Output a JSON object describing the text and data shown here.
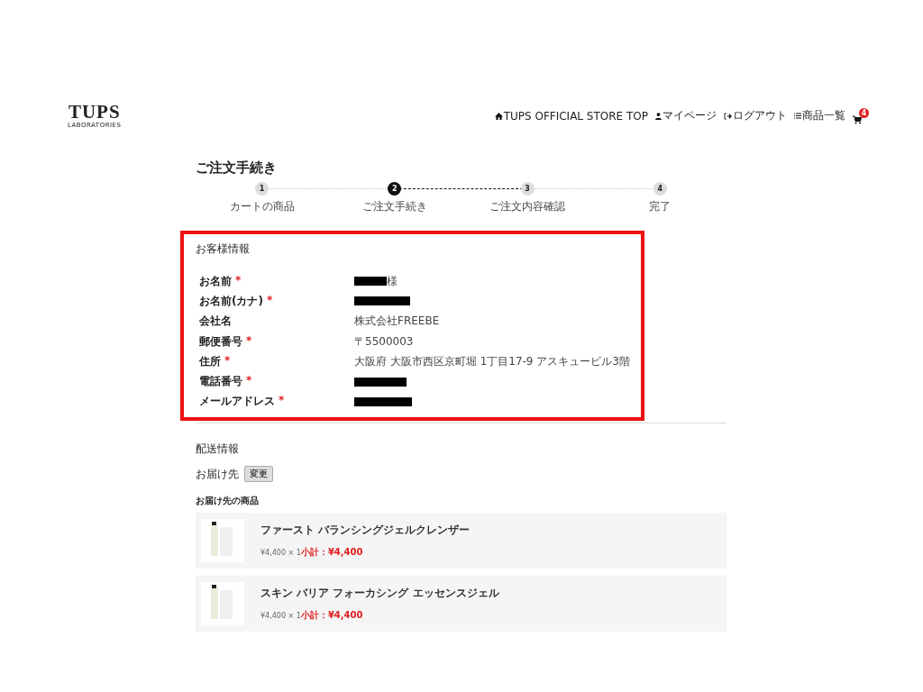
{
  "header": {
    "logo": {
      "title": "TUPS",
      "subtitle": "LABORATORIES"
    },
    "nav": [
      {
        "kind": "home",
        "label": "TUPS OFFICIAL STORE TOP"
      },
      {
        "kind": "user",
        "label": "マイページ"
      },
      {
        "kind": "logout",
        "label": "ログアウト"
      },
      {
        "kind": "list",
        "label": "商品一覧"
      },
      {
        "kind": "cart",
        "badge": "4"
      }
    ]
  },
  "page_title": "ご注文手続き",
  "steps": [
    {
      "number": "1",
      "label": "カートの商品",
      "selected": false
    },
    {
      "number": "2",
      "label": "ご注文手続き",
      "selected": true
    },
    {
      "number": "3",
      "label": "ご注文内容確認",
      "selected": false
    },
    {
      "number": "4",
      "label": "完了",
      "selected": false
    }
  ],
  "customer": {
    "title": "お客様情報",
    "highlighted": true,
    "rows": [
      {
        "label": "お名前",
        "required_mark": "*",
        "redacted": true,
        "suffix": "様"
      },
      {
        "label": "お名前(カナ)",
        "required_mark": "*",
        "redacted": true
      },
      {
        "label": "会社名",
        "value": "株式会社FREEBE"
      },
      {
        "label": "郵便番号",
        "required_mark": "*",
        "value": "〒5500003"
      },
      {
        "label": "住所",
        "required_mark": "*",
        "value": "大阪府 大阪市西区京町堀 1丁目17-9 アスキュービル3階"
      },
      {
        "label": "電話番号",
        "required_mark": "*",
        "redacted": true
      },
      {
        "label": "メールアドレス",
        "required_mark": "*",
        "redacted": true
      }
    ]
  },
  "shipping": {
    "title": "配送情報",
    "destination_title": "お届け先",
    "change_button": "変更",
    "items_title": "お届け先の商品",
    "items": [
      {
        "name": "ファースト バランシングジェルクレンザー",
        "price": "¥4,400 × 1",
        "subtotal": "小計：¥4,400"
      },
      {
        "name": "スキン バリア フォーカシング エッセンスジェル",
        "price": "¥4,400 × 1",
        "subtotal": "小計：¥4,400"
      }
    ]
  }
}
